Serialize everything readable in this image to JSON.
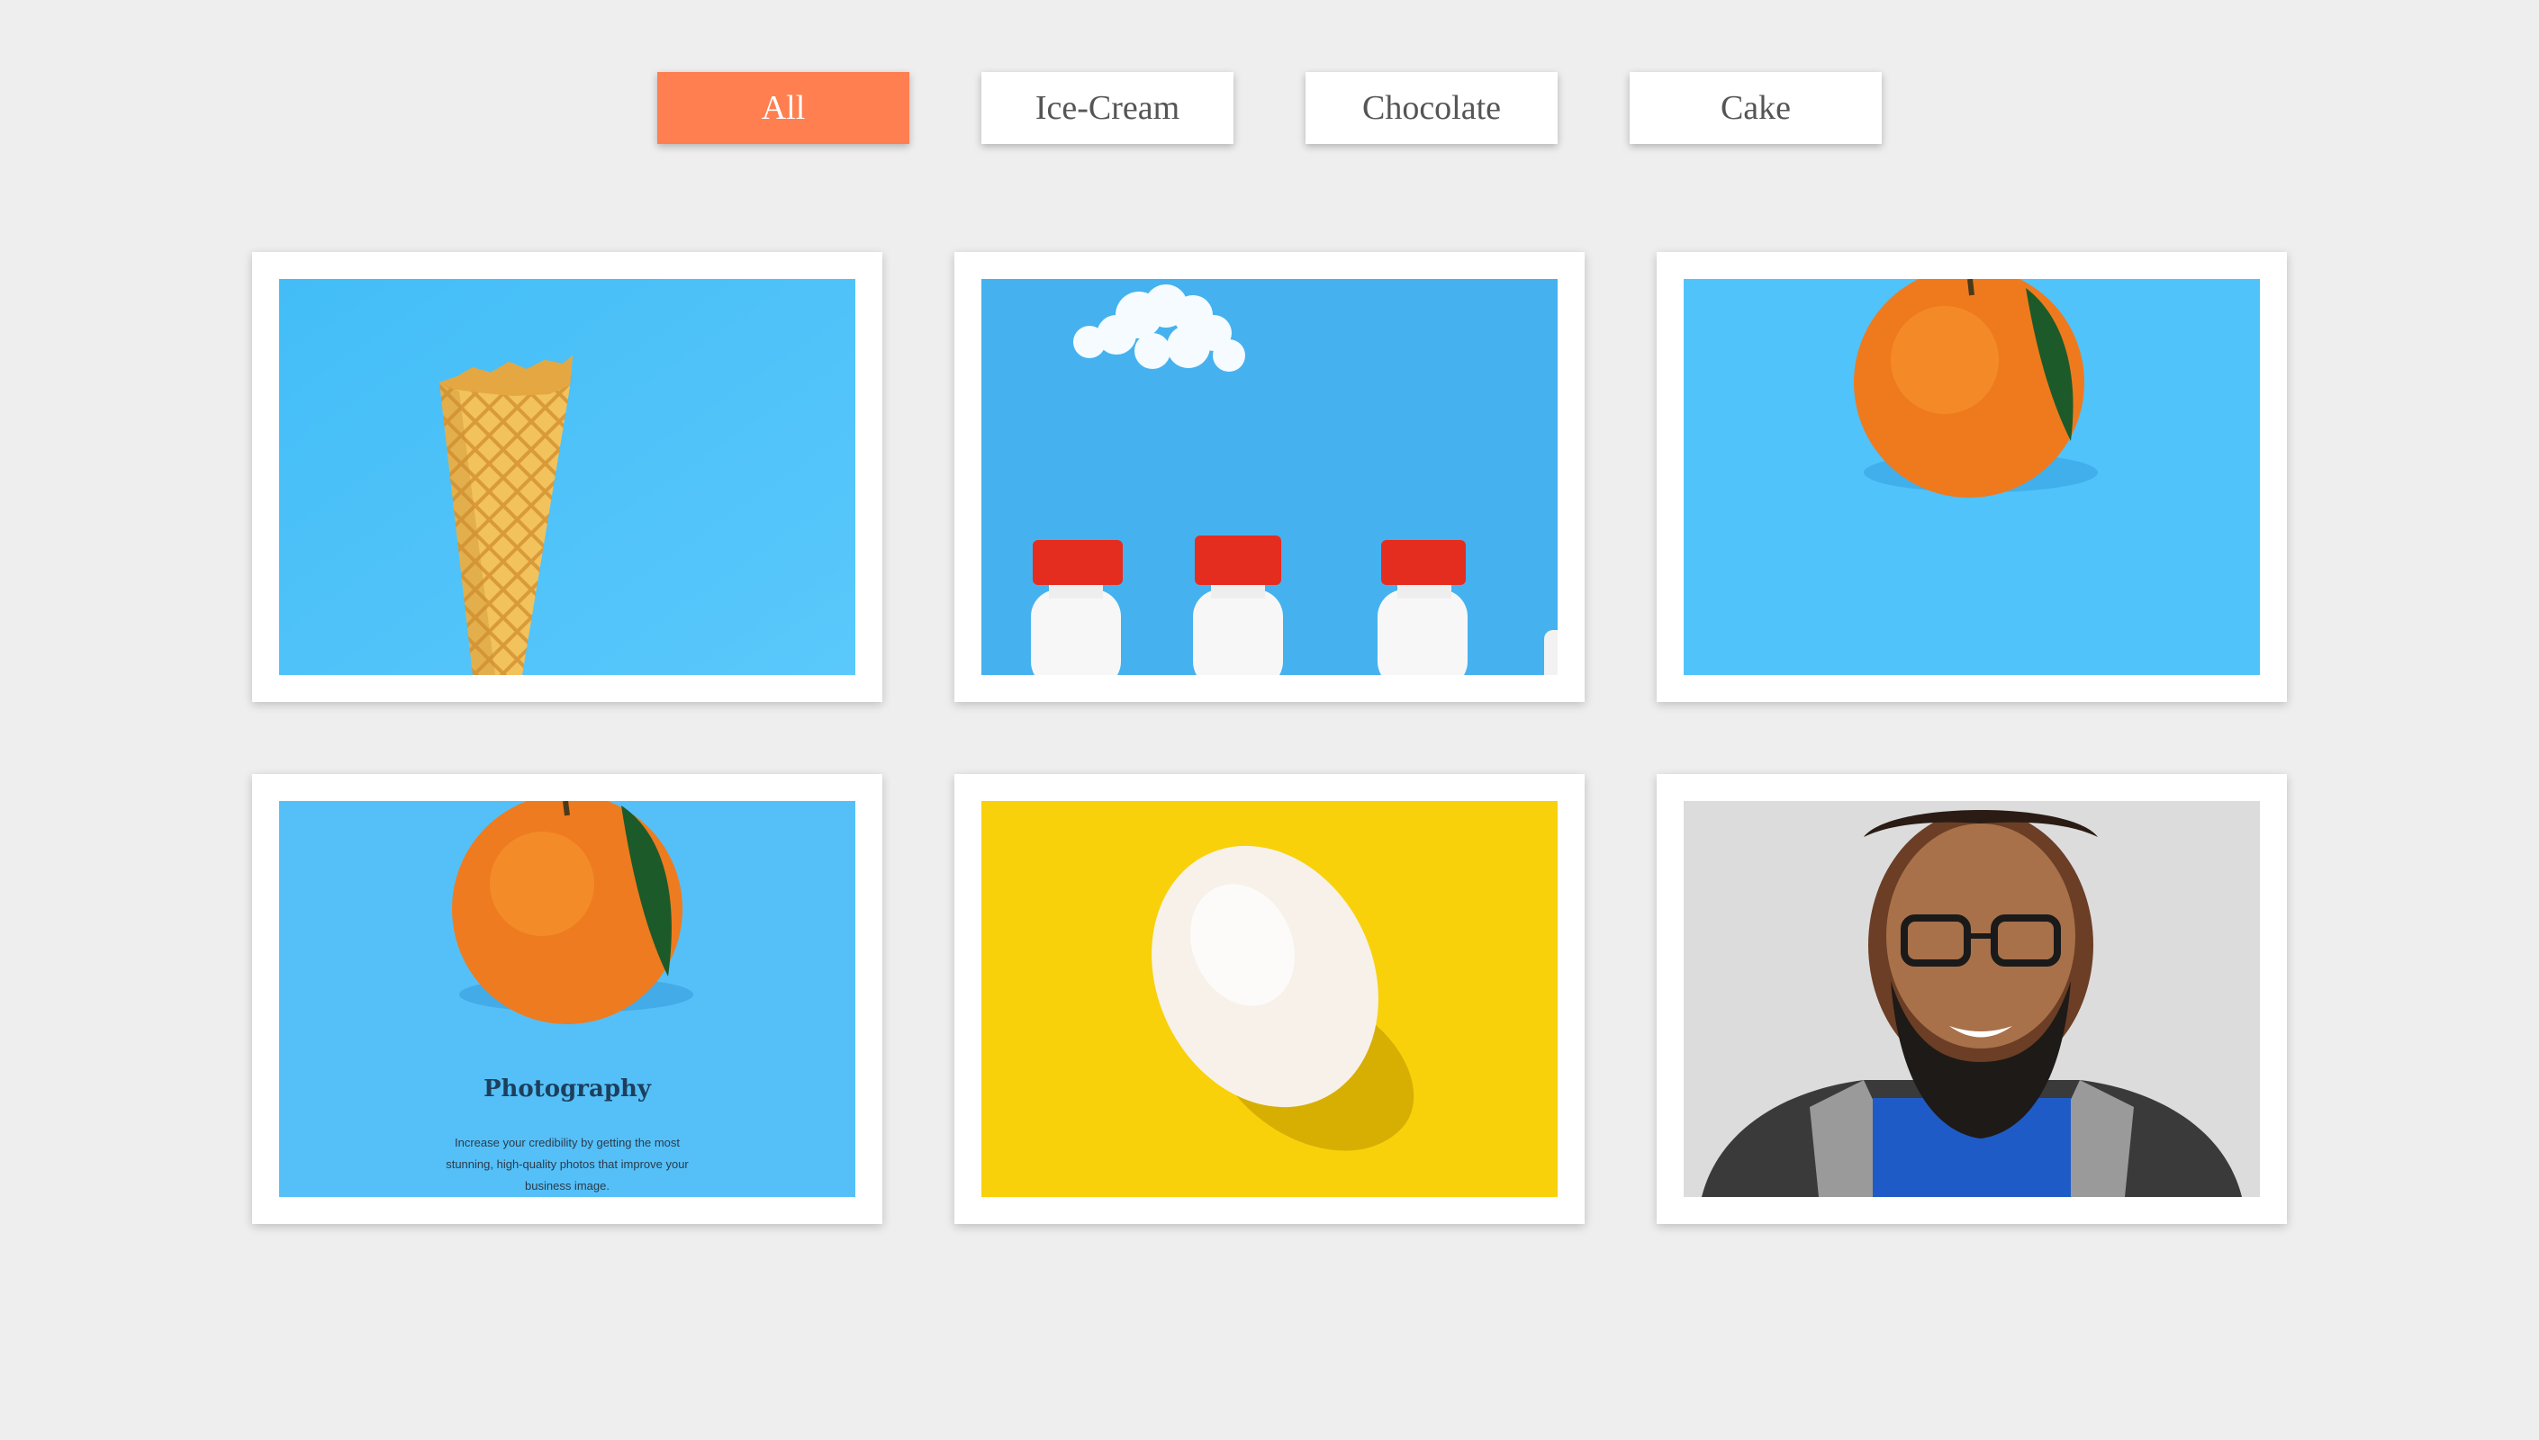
{
  "filters": {
    "all": "All",
    "ice_cream": "Ice-Cream",
    "chocolate": "Chocolate",
    "cake": "Cake",
    "active_color": "#ff7f50"
  },
  "gallery": {
    "cards": [
      {
        "subject": "waffle-cone"
      },
      {
        "subject": "milk-bottles"
      },
      {
        "subject": "orange"
      },
      {
        "subject": "orange-photography",
        "title": "Photography",
        "description": "Increase your credibility by getting the most stunning, high-quality photos that improve your business image."
      },
      {
        "subject": "egg"
      },
      {
        "subject": "smiling-man"
      }
    ]
  },
  "colors": {
    "background": "#eeeeee",
    "sky_blue": "#4ec3fa",
    "yellow": "#fbd400"
  }
}
